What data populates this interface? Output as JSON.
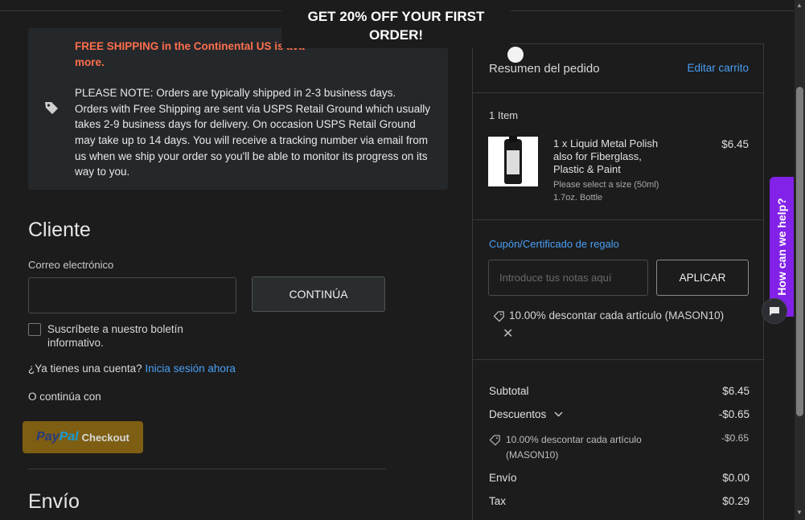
{
  "promo": {
    "text": "GET 20% OFF YOUR FIRST ORDER!"
  },
  "notice": {
    "free_shipping": "FREE SHIPPING in the Continental US is available on all orders of . For more.",
    "free_shipping_visible": "FREE SHIPPING in the Continental US is ava",
    "free_shipping_line2": "more.",
    "note": "PLEASE NOTE: Orders are typically shipped in 2-3 business days. Orders with Free Shipping are sent via USPS Retail Ground which usually takes 2-9 business days for delivery. On occasion USPS Retail Ground may take up to 14 days. You will receive a tracking number via email from us when we ship your order so you'll be able to monitor its progress on its way to you."
  },
  "customer": {
    "heading": "Cliente",
    "email_label": "Correo electrónico",
    "continue_button": "CONTINÚA",
    "newsletter_label": "Suscríbete a nuestro boletín informativo.",
    "account_prompt": "¿Ya tienes una cuenta?",
    "login_link": "Inicia sesión ahora",
    "or_continue": "O continúa con",
    "paypal_pay": "Pay",
    "paypal_pal": "Pal",
    "paypal_checkout": "Checkout"
  },
  "shipping": {
    "heading": "Envío"
  },
  "summary": {
    "title": "Resumen del pedido",
    "edit_cart": "Editar carrito",
    "item_count": "1 Item",
    "product": {
      "name": "1 x Liquid Metal Polish also for Fiberglass, Plastic & Paint",
      "option": "Please select a size (50ml)",
      "option2": "1.7oz. Bottle",
      "price": "$6.45"
    },
    "coupon_link": "Cupón/Certificado de regalo",
    "coupon_placeholder": "Introduce tus notas aquí",
    "apply_button": "APLICAR",
    "applied_coupon": "10.00% descontar cada artículo (MASON10)",
    "subtotal_label": "Subtotal",
    "subtotal_value": "$6.45",
    "discounts_label": "Descuentos",
    "discounts_value": "-$0.65",
    "discount_line": "10.00% descontar cada artículo (MASON10)",
    "discount_line_value": "-$0.65",
    "shipping_label": "Envío",
    "shipping_value": "$0.00",
    "tax_label": "Tax",
    "tax_value": "$0.29"
  },
  "help_widget": {
    "label": "How can we help?"
  },
  "colors": {
    "accent_link": "#4a9ff5",
    "help_purple": "#8222e8",
    "free_shipping_orange": "#ff6f4d",
    "paypal_gold": "#7d5e12"
  },
  "icons": [
    "tag-icon",
    "chevron-down-icon",
    "close-icon",
    "chat-icon"
  ]
}
